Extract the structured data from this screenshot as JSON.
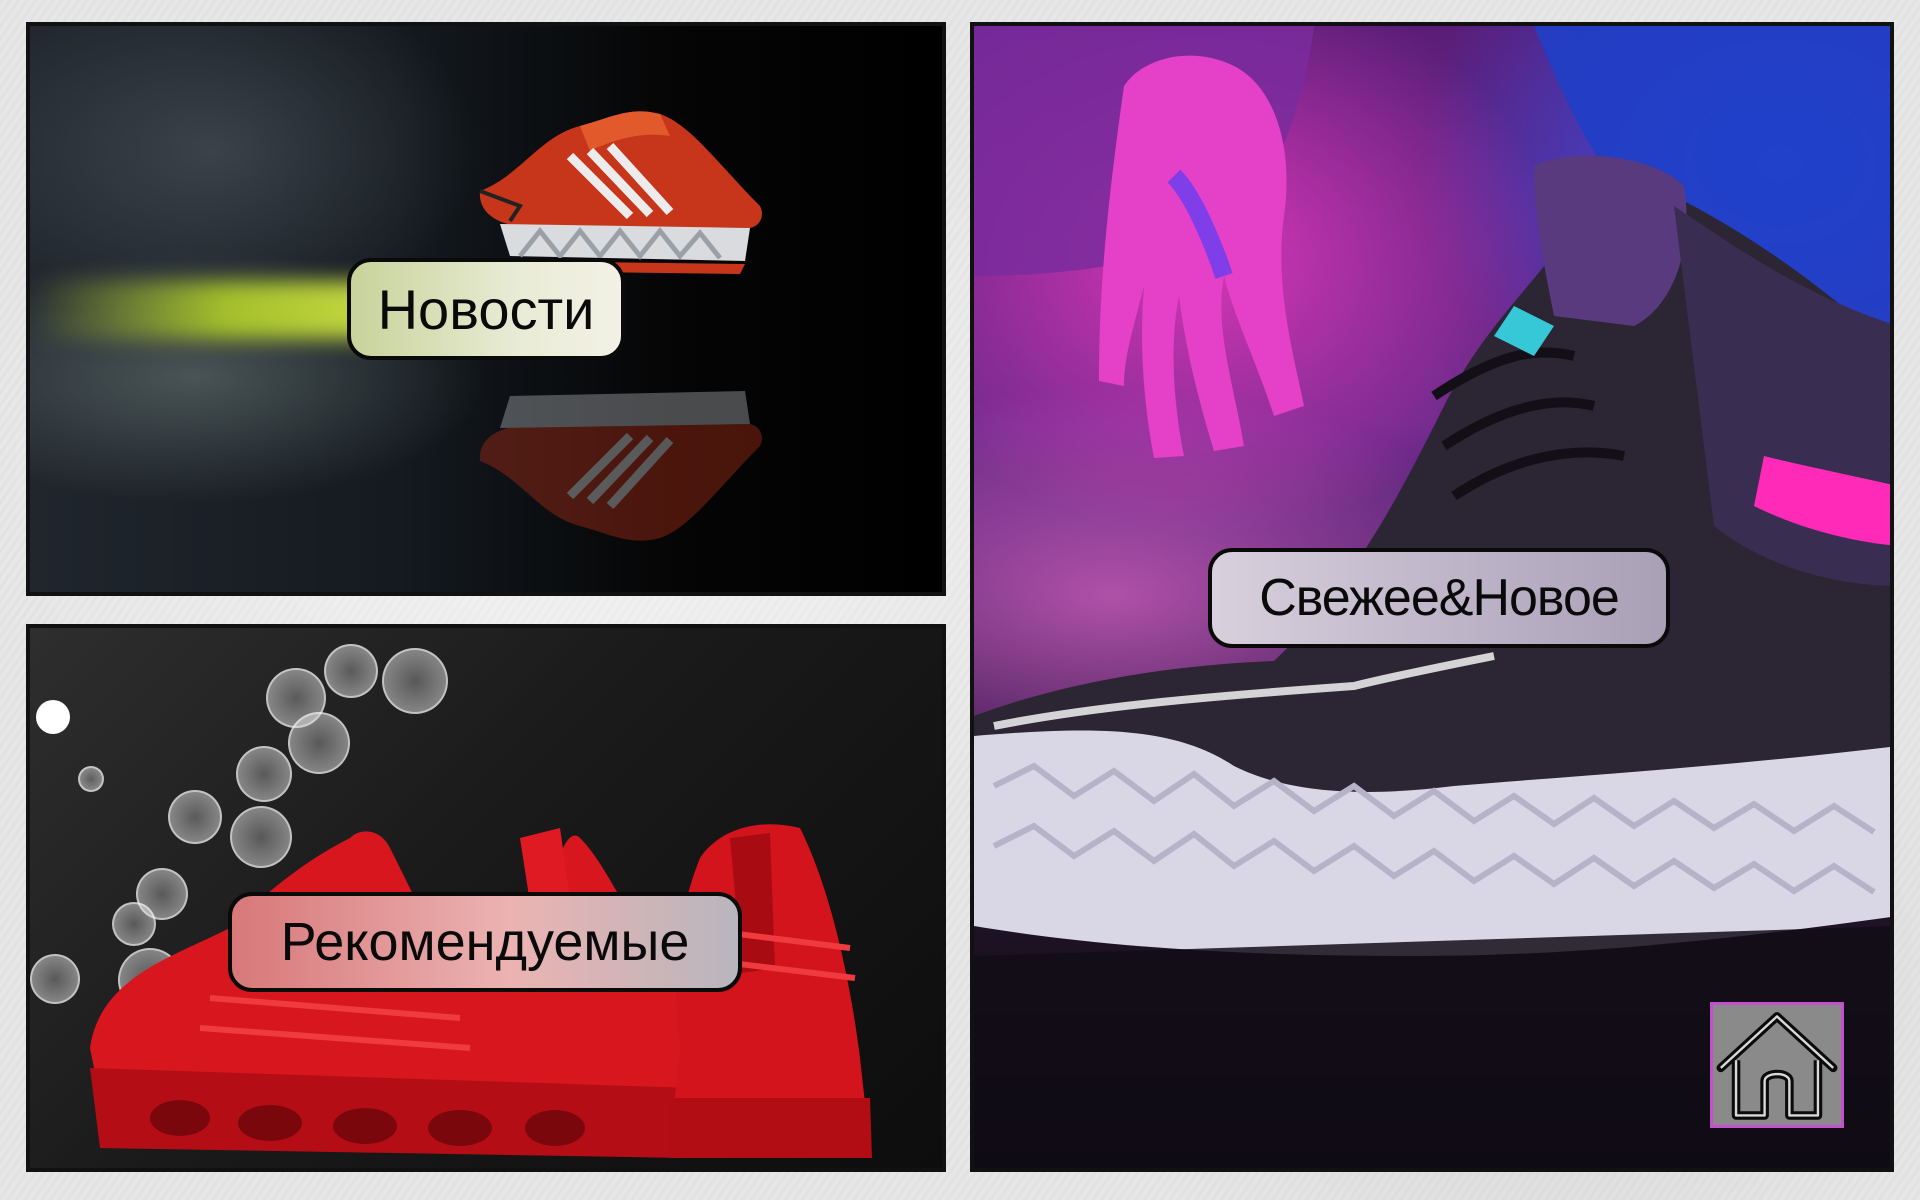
{
  "tiles": {
    "news": {
      "label": "Новости"
    },
    "recommended": {
      "label": "Рекомендуемые"
    },
    "fresh": {
      "label": "Свежее&Новое"
    }
  },
  "home": {
    "icon": "home-icon"
  },
  "colors": {
    "border": "#111111",
    "home_border": "#c44fd0",
    "home_fill": "#8a8a8a"
  }
}
